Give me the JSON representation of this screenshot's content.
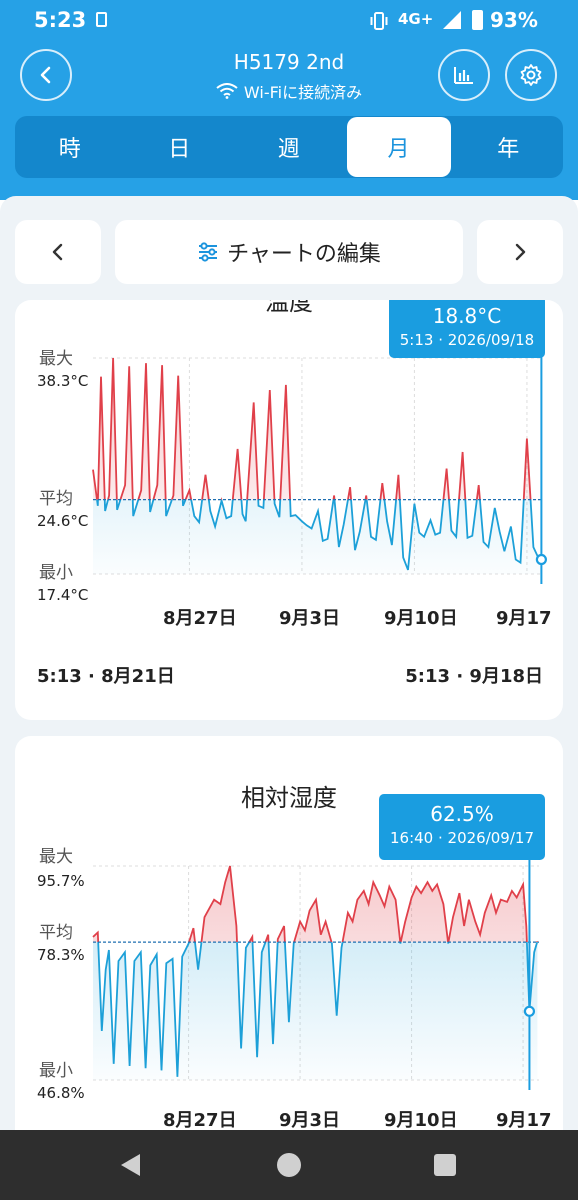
{
  "status": {
    "time": "5:23",
    "network": "4G+",
    "battery": "93%"
  },
  "header": {
    "device_name": "H5179 2nd",
    "connection": "Wi-Fiに接続済み",
    "icons": {
      "back": "chevron-left-icon",
      "chart": "bar-chart-icon",
      "settings": "gear-icon"
    }
  },
  "tabs": [
    {
      "label": "時",
      "active": false
    },
    {
      "label": "日",
      "active": false
    },
    {
      "label": "週",
      "active": false
    },
    {
      "label": "月",
      "active": true
    },
    {
      "label": "年",
      "active": false
    }
  ],
  "toolbar": {
    "edit_label": "チャートの編集"
  },
  "colors": {
    "accent": "#26a1e6",
    "line_blue": "#1da0d8",
    "line_red": "#e0404a"
  },
  "chart_data": [
    {
      "type": "line",
      "title": "温度",
      "ylabel_max": "最大",
      "ylabel_avg": "平均",
      "ylabel_min": "最小",
      "y_max_label": "38.3°C",
      "y_avg_label": "24.6°C",
      "y_min_label": "17.4°C",
      "ylim": [
        17.4,
        38.3
      ],
      "avg": 24.6,
      "x_ticks": [
        {
          "label": "8月27日",
          "day": 6
        },
        {
          "label": "9月3日",
          "day": 13
        },
        {
          "label": "9月10日",
          "day": 20
        },
        {
          "label": "9月17",
          "day": 27
        }
      ],
      "range_start": "5:13 · 8月21日",
      "range_end": "5:13 · 9月18日",
      "tooltip": {
        "value": "18.8°C",
        "time": "5:13 · 2026/09/18"
      },
      "tooltip_day": 27.9,
      "days": 28,
      "series": [
        {
          "day": 0,
          "value": 27.5
        },
        {
          "day": 0.3,
          "value": 24.0
        },
        {
          "day": 0.5,
          "value": 36.5
        },
        {
          "day": 0.75,
          "value": 23.5
        },
        {
          "day": 1.0,
          "value": 25.0
        },
        {
          "day": 1.25,
          "value": 38.3
        },
        {
          "day": 1.5,
          "value": 23.6
        },
        {
          "day": 2.0,
          "value": 26.0
        },
        {
          "day": 2.25,
          "value": 37.5
        },
        {
          "day": 2.5,
          "value": 23.0
        },
        {
          "day": 3.0,
          "value": 25.5
        },
        {
          "day": 3.3,
          "value": 37.8
        },
        {
          "day": 3.55,
          "value": 23.4
        },
        {
          "day": 4.0,
          "value": 26.0
        },
        {
          "day": 4.3,
          "value": 37.6
        },
        {
          "day": 4.55,
          "value": 23.0
        },
        {
          "day": 5.0,
          "value": 25.0
        },
        {
          "day": 5.3,
          "value": 36.6
        },
        {
          "day": 5.6,
          "value": 24.0
        },
        {
          "day": 6.0,
          "value": 25.5
        },
        {
          "day": 6.3,
          "value": 23.0
        },
        {
          "day": 6.6,
          "value": 22.4
        },
        {
          "day": 7.0,
          "value": 27.0
        },
        {
          "day": 7.3,
          "value": 23.5
        },
        {
          "day": 7.6,
          "value": 22.0
        },
        {
          "day": 8.0,
          "value": 24.5
        },
        {
          "day": 8.3,
          "value": 22.8
        },
        {
          "day": 8.6,
          "value": 23.0
        },
        {
          "day": 9.0,
          "value": 29.5
        },
        {
          "day": 9.3,
          "value": 23.2
        },
        {
          "day": 9.5,
          "value": 22.5
        },
        {
          "day": 10.0,
          "value": 34.0
        },
        {
          "day": 10.3,
          "value": 24.0
        },
        {
          "day": 10.6,
          "value": 23.8
        },
        {
          "day": 11.0,
          "value": 35.2
        },
        {
          "day": 11.3,
          "value": 24.2
        },
        {
          "day": 11.6,
          "value": 22.9
        },
        {
          "day": 12.0,
          "value": 35.7
        },
        {
          "day": 12.3,
          "value": 23.0
        },
        {
          "day": 12.6,
          "value": 23.1
        },
        {
          "day": 13.0,
          "value": 22.5
        },
        {
          "day": 13.3,
          "value": 22.1
        },
        {
          "day": 13.6,
          "value": 21.8
        },
        {
          "day": 14.0,
          "value": 23.5
        },
        {
          "day": 14.3,
          "value": 20.6
        },
        {
          "day": 14.6,
          "value": 20.8
        },
        {
          "day": 15.0,
          "value": 25.0
        },
        {
          "day": 15.3,
          "value": 20.0
        },
        {
          "day": 15.6,
          "value": 22.2
        },
        {
          "day": 16.0,
          "value": 25.8
        },
        {
          "day": 16.3,
          "value": 19.7
        },
        {
          "day": 16.6,
          "value": 21.5
        },
        {
          "day": 17.0,
          "value": 25.0
        },
        {
          "day": 17.3,
          "value": 21.0
        },
        {
          "day": 17.6,
          "value": 20.7
        },
        {
          "day": 18.0,
          "value": 26.2
        },
        {
          "day": 18.3,
          "value": 22.5
        },
        {
          "day": 18.6,
          "value": 20.2
        },
        {
          "day": 19.0,
          "value": 27.0
        },
        {
          "day": 19.3,
          "value": 19.0
        },
        {
          "day": 19.6,
          "value": 17.8
        },
        {
          "day": 20.0,
          "value": 24.2
        },
        {
          "day": 20.3,
          "value": 21.4
        },
        {
          "day": 20.6,
          "value": 21.0
        },
        {
          "day": 21.0,
          "value": 22.6
        },
        {
          "day": 21.3,
          "value": 21.2
        },
        {
          "day": 21.6,
          "value": 21.4
        },
        {
          "day": 22.0,
          "value": 27.6
        },
        {
          "day": 22.3,
          "value": 21.6
        },
        {
          "day": 22.6,
          "value": 21.0
        },
        {
          "day": 23.0,
          "value": 29.2
        },
        {
          "day": 23.3,
          "value": 20.9
        },
        {
          "day": 23.6,
          "value": 21.1
        },
        {
          "day": 24.0,
          "value": 26.0
        },
        {
          "day": 24.3,
          "value": 20.5
        },
        {
          "day": 24.6,
          "value": 20.0
        },
        {
          "day": 25.0,
          "value": 23.8
        },
        {
          "day": 25.3,
          "value": 21.5
        },
        {
          "day": 25.6,
          "value": 19.6
        },
        {
          "day": 26.0,
          "value": 22.0
        },
        {
          "day": 26.3,
          "value": 18.8
        },
        {
          "day": 26.6,
          "value": 18.5
        },
        {
          "day": 27.0,
          "value": 30.5
        },
        {
          "day": 27.4,
          "value": 20.0
        },
        {
          "day": 27.7,
          "value": 19.0
        },
        {
          "day": 27.9,
          "value": 18.8
        }
      ]
    },
    {
      "type": "line",
      "title": "相対湿度",
      "ylabel_max": "最大",
      "ylabel_avg": "平均",
      "ylabel_min": "最小",
      "y_max_label": "95.7%",
      "y_avg_label": "78.3%",
      "y_min_label": "46.8%",
      "ylim": [
        46.8,
        95.7
      ],
      "avg": 78.3,
      "x_ticks": [
        {
          "label": "8月27日",
          "day": 6
        },
        {
          "label": "9月3日",
          "day": 13
        },
        {
          "label": "9月10日",
          "day": 20
        },
        {
          "label": "9月17",
          "day": 27
        }
      ],
      "tooltip": {
        "value": "62.5%",
        "time": "16:40 · 2026/09/17"
      },
      "tooltip_day": 27.4,
      "days": 28,
      "series": [
        {
          "day": 0,
          "value": 79.5
        },
        {
          "day": 0.3,
          "value": 80.5
        },
        {
          "day": 0.55,
          "value": 58.0
        },
        {
          "day": 0.8,
          "value": 72.0
        },
        {
          "day": 1.0,
          "value": 76.5
        },
        {
          "day": 1.3,
          "value": 50.5
        },
        {
          "day": 1.6,
          "value": 74.0
        },
        {
          "day": 2.0,
          "value": 76.0
        },
        {
          "day": 2.3,
          "value": 50.0
        },
        {
          "day": 2.6,
          "value": 74.0
        },
        {
          "day": 3.0,
          "value": 76.0
        },
        {
          "day": 3.3,
          "value": 49.5
        },
        {
          "day": 3.6,
          "value": 73.0
        },
        {
          "day": 4.0,
          "value": 75.5
        },
        {
          "day": 4.3,
          "value": 49.0
        },
        {
          "day": 4.6,
          "value": 73.5
        },
        {
          "day": 5.0,
          "value": 74.5
        },
        {
          "day": 5.3,
          "value": 47.5
        },
        {
          "day": 5.6,
          "value": 75.0
        },
        {
          "day": 6.0,
          "value": 78.0
        },
        {
          "day": 6.3,
          "value": 81.5
        },
        {
          "day": 6.6,
          "value": 72.0
        },
        {
          "day": 7.0,
          "value": 84.0
        },
        {
          "day": 7.3,
          "value": 86.0
        },
        {
          "day": 7.6,
          "value": 88.0
        },
        {
          "day": 8.0,
          "value": 87.0
        },
        {
          "day": 8.3,
          "value": 92.0
        },
        {
          "day": 8.6,
          "value": 95.7
        },
        {
          "day": 9.0,
          "value": 82.0
        },
        {
          "day": 9.3,
          "value": 54.0
        },
        {
          "day": 9.6,
          "value": 77.0
        },
        {
          "day": 10.0,
          "value": 79.5
        },
        {
          "day": 10.3,
          "value": 52.0
        },
        {
          "day": 10.6,
          "value": 76.0
        },
        {
          "day": 11.0,
          "value": 80.0
        },
        {
          "day": 11.3,
          "value": 55.0
        },
        {
          "day": 11.6,
          "value": 79.0
        },
        {
          "day": 12.0,
          "value": 82.0
        },
        {
          "day": 12.3,
          "value": 60.0
        },
        {
          "day": 12.6,
          "value": 78.0
        },
        {
          "day": 13.0,
          "value": 83.0
        },
        {
          "day": 13.3,
          "value": 81.0
        },
        {
          "day": 13.6,
          "value": 85.5
        },
        {
          "day": 14.0,
          "value": 88.0
        },
        {
          "day": 14.3,
          "value": 80.0
        },
        {
          "day": 14.6,
          "value": 83.0
        },
        {
          "day": 15.0,
          "value": 78.0
        },
        {
          "day": 15.3,
          "value": 61.5
        },
        {
          "day": 15.6,
          "value": 77.0
        },
        {
          "day": 16.0,
          "value": 85.0
        },
        {
          "day": 16.3,
          "value": 83.0
        },
        {
          "day": 16.6,
          "value": 88.0
        },
        {
          "day": 17.0,
          "value": 90.0
        },
        {
          "day": 17.3,
          "value": 87.0
        },
        {
          "day": 17.6,
          "value": 92.0
        },
        {
          "day": 18.0,
          "value": 89.0
        },
        {
          "day": 18.3,
          "value": 86.5
        },
        {
          "day": 18.6,
          "value": 91.0
        },
        {
          "day": 19.0,
          "value": 88.0
        },
        {
          "day": 19.3,
          "value": 78.0
        },
        {
          "day": 19.6,
          "value": 83.0
        },
        {
          "day": 20.0,
          "value": 88.5
        },
        {
          "day": 20.3,
          "value": 91.0
        },
        {
          "day": 20.6,
          "value": 89.5
        },
        {
          "day": 21.0,
          "value": 92.0
        },
        {
          "day": 21.3,
          "value": 90.0
        },
        {
          "day": 21.6,
          "value": 91.5
        },
        {
          "day": 22.0,
          "value": 87.0
        },
        {
          "day": 22.3,
          "value": 78.0
        },
        {
          "day": 22.6,
          "value": 84.0
        },
        {
          "day": 23.0,
          "value": 89.5
        },
        {
          "day": 23.3,
          "value": 82.0
        },
        {
          "day": 23.6,
          "value": 88.0
        },
        {
          "day": 24.0,
          "value": 83.0
        },
        {
          "day": 24.3,
          "value": 80.0
        },
        {
          "day": 24.6,
          "value": 85.0
        },
        {
          "day": 25.0,
          "value": 89.0
        },
        {
          "day": 25.3,
          "value": 85.0
        },
        {
          "day": 25.6,
          "value": 88.0
        },
        {
          "day": 26.0,
          "value": 87.5
        },
        {
          "day": 26.3,
          "value": 90.0
        },
        {
          "day": 26.6,
          "value": 88.5
        },
        {
          "day": 27.0,
          "value": 91.5
        },
        {
          "day": 27.2,
          "value": 82.0
        },
        {
          "day": 27.4,
          "value": 62.5
        },
        {
          "day": 27.7,
          "value": 76.0
        },
        {
          "day": 27.9,
          "value": 78.5
        }
      ]
    }
  ]
}
